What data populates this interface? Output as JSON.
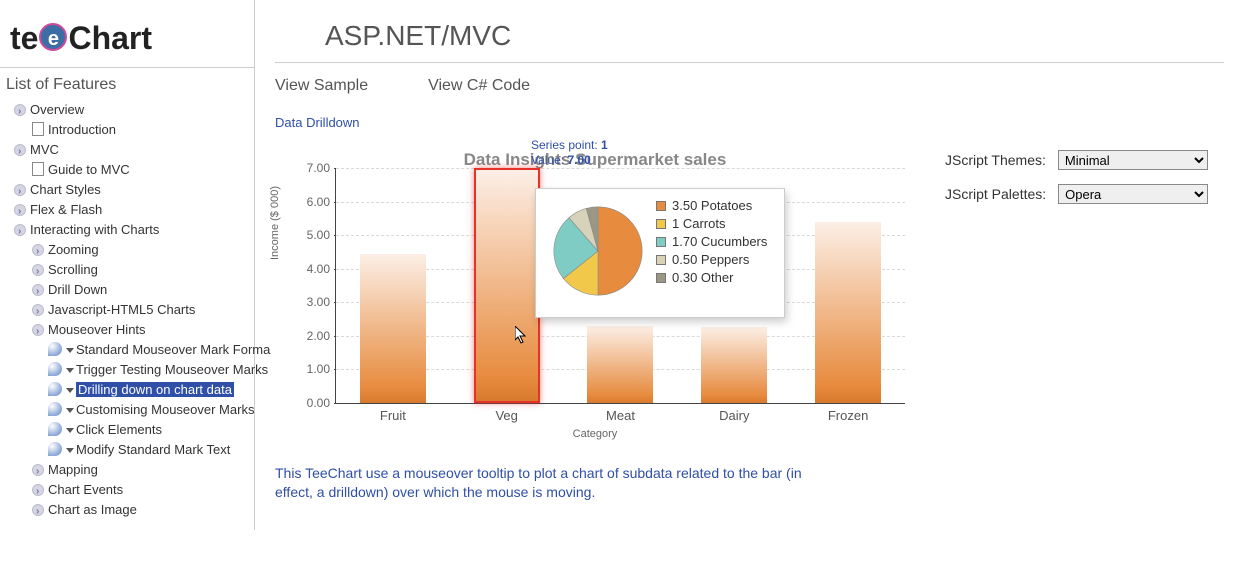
{
  "logo": {
    "prefix": "te",
    "e": "e",
    "suffix": "Chart"
  },
  "header_title": "ASP.NET/MVC",
  "sidebar_title": "List of Features",
  "tree": {
    "overview": "Overview",
    "introduction": "Introduction",
    "mvc": "MVC",
    "guide_mvc": "Guide to MVC",
    "chart_styles": "Chart Styles",
    "flex_flash": "Flex & Flash",
    "interacting": "Interacting with Charts",
    "zooming": "Zooming",
    "scrolling": "Scrolling",
    "drilldown": "Drill Down",
    "js_html5": "Javascript-HTML5 Charts",
    "mouseover": "Mouseover Hints",
    "std_marks": "Standard Mouseover Mark Forma",
    "trigger": "Trigger Testing Mouseover Marks",
    "drilling_chart": "Drilling down on chart data",
    "customising": "Customising Mouseover Marks",
    "click_el": "Click Elements",
    "modify_mark": "Modify Standard Mark Text",
    "mapping": "Mapping",
    "chart_events": "Chart Events",
    "chart_image": "Chart as Image"
  },
  "tabs": {
    "sample": "View Sample",
    "code": "View C# Code"
  },
  "section": "Data Drilldown",
  "chart_title": "Data Insights Supermarket sales",
  "chart_ylabel": "Income ($ 000)",
  "chart_xlabel": "Category",
  "hint_line1_prefix": "Series point: ",
  "hint_line1_value": "1",
  "hint_line2_prefix": "Value: ",
  "hint_line2_value": "7.00",
  "description": "This TeeChart use a mouseover tooltip to plot a chart of subdata related to the bar (in effect, a drilldown) over which the mouse is moving.",
  "controls": {
    "themes_label": "JScript Themes:",
    "themes_value": "Minimal",
    "palettes_label": "JScript Palettes:",
    "palettes_value": "Opera"
  },
  "chart_data": {
    "type": "bar",
    "title": "Data Insights Supermarket sales",
    "xlabel": "Category",
    "ylabel": "Income ($ 000)",
    "ylim": [
      0,
      7
    ],
    "yticks": [
      0.0,
      1.0,
      2.0,
      3.0,
      4.0,
      5.0,
      6.0,
      7.0
    ],
    "categories": [
      "Fruit",
      "Veg",
      "Meat",
      "Dairy",
      "Frozen"
    ],
    "values": [
      4.45,
      7.0,
      2.3,
      2.25,
      5.4
    ],
    "highlight_index": 1,
    "tooltip_pie": {
      "type": "pie",
      "slices": [
        {
          "label": "Potatoes",
          "value": 3.5,
          "color": "#e78b3e"
        },
        {
          "label": "Carrots",
          "value": 1,
          "color": "#f2c84b"
        },
        {
          "label": "Cucumbers",
          "value": 1.7,
          "color": "#7fccc4"
        },
        {
          "label": "Peppers",
          "value": 0.5,
          "color": "#d9d2bb"
        },
        {
          "label": "Other",
          "value": 0.3,
          "color": "#9c9785"
        }
      ]
    }
  }
}
